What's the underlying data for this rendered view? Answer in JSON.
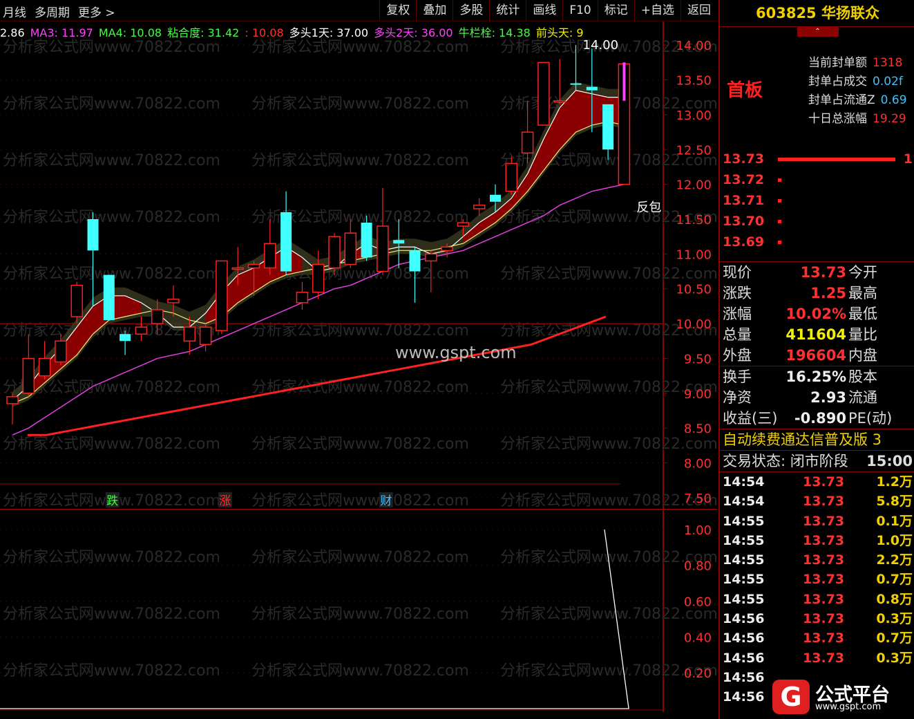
{
  "toolbar": {
    "left": [
      "月线",
      "多周期",
      "更多 >"
    ],
    "right": [
      "复权",
      "叠加",
      "多股",
      "统计",
      "画线",
      "F10",
      "标记",
      "+自选",
      "返回"
    ]
  },
  "ma_line": [
    {
      "label": "2.86",
      "color": "#ffffff"
    },
    {
      "label": "MA3: 11.97",
      "color": "#ff40ff"
    },
    {
      "label": "MA4: 10.08",
      "color": "#40ff40"
    },
    {
      "label": "粘合度: 31.42",
      "color": "#40ff40"
    },
    {
      "label": ": 10.08",
      "color": "#ff3030"
    },
    {
      "label": "多头1天: 37.00",
      "color": "#ffffff"
    },
    {
      "label": "多头2天: 36.00",
      "color": "#ff40ff"
    },
    {
      "label": "牛栏栓: 14.38",
      "color": "#40ff40"
    },
    {
      "label": "前头天: 9",
      "color": "#f0f000"
    }
  ],
  "chart_data": [
    {
      "type": "candlestick",
      "ylim": [
        7.35,
        14.25
      ],
      "yticks": [
        "14.00",
        "13.50",
        "13.00",
        "12.50",
        "12.00",
        "11.50",
        "11.00",
        "10.50",
        "10.00",
        "9.50",
        "9.00",
        "8.50",
        "8.00",
        "7.50"
      ],
      "ytick_values": [
        14.0,
        13.5,
        13.0,
        12.5,
        12.0,
        11.5,
        11.0,
        10.5,
        10.0,
        9.5,
        9.0,
        8.5,
        8.0,
        7.5
      ],
      "candles": [
        {
          "o": 8.85,
          "h": 9.0,
          "l": 8.55,
          "c": 8.95,
          "up": true
        },
        {
          "o": 9.0,
          "h": 9.85,
          "l": 8.95,
          "c": 9.5,
          "up": true
        },
        {
          "o": 9.25,
          "h": 9.75,
          "l": 9.2,
          "c": 9.5,
          "up": true
        },
        {
          "o": 9.45,
          "h": 9.85,
          "l": 9.4,
          "c": 9.75,
          "up": true
        },
        {
          "o": 10.1,
          "h": 10.6,
          "l": 10.0,
          "c": 10.55,
          "up": true
        },
        {
          "o": 11.5,
          "h": 11.6,
          "l": 10.25,
          "c": 11.05,
          "up": false
        },
        {
          "o": 10.7,
          "h": 10.7,
          "l": 10.05,
          "c": 10.05,
          "up": false
        },
        {
          "o": 9.85,
          "h": 9.9,
          "l": 9.55,
          "c": 9.75,
          "up": false
        },
        {
          "o": 9.85,
          "h": 10.1,
          "l": 9.75,
          "c": 9.95,
          "up": true
        },
        {
          "o": 10.0,
          "h": 10.35,
          "l": 9.85,
          "c": 10.2,
          "up": true
        },
        {
          "o": 10.3,
          "h": 10.55,
          "l": 10.1,
          "c": 10.35,
          "up": true
        },
        {
          "o": 9.95,
          "h": 10.1,
          "l": 9.55,
          "c": 9.75,
          "up": true
        },
        {
          "o": 9.7,
          "h": 10.0,
          "l": 9.6,
          "c": 9.95,
          "up": true
        },
        {
          "o": 9.9,
          "h": 10.9,
          "l": 9.85,
          "c": 10.9,
          "up": true
        },
        {
          "o": 10.8,
          "h": 11.1,
          "l": 10.55,
          "c": 10.8,
          "up": true
        },
        {
          "o": 10.8,
          "h": 10.9,
          "l": 10.4,
          "c": 10.85,
          "up": true
        },
        {
          "o": 10.8,
          "h": 11.5,
          "l": 10.7,
          "c": 11.15,
          "up": true
        },
        {
          "o": 11.6,
          "h": 11.9,
          "l": 10.7,
          "c": 10.75,
          "up": false
        },
        {
          "o": 10.3,
          "h": 10.6,
          "l": 10.2,
          "c": 10.45,
          "up": true
        },
        {
          "o": 10.45,
          "h": 11.05,
          "l": 10.35,
          "c": 10.85,
          "up": true
        },
        {
          "o": 10.8,
          "h": 11.3,
          "l": 10.7,
          "c": 11.25,
          "up": true
        },
        {
          "o": 10.85,
          "h": 11.5,
          "l": 10.8,
          "c": 11.3,
          "up": true
        },
        {
          "o": 11.45,
          "h": 11.55,
          "l": 10.9,
          "c": 10.95,
          "up": false
        },
        {
          "o": 10.75,
          "h": 11.95,
          "l": 10.7,
          "c": 11.4,
          "up": true
        },
        {
          "o": 11.2,
          "h": 11.5,
          "l": 10.8,
          "c": 11.15,
          "up": false
        },
        {
          "o": 11.05,
          "h": 11.1,
          "l": 10.3,
          "c": 10.75,
          "up": false
        },
        {
          "o": 10.9,
          "h": 11.05,
          "l": 10.45,
          "c": 11.0,
          "up": true
        },
        {
          "o": 11.05,
          "h": 11.15,
          "l": 10.95,
          "c": 11.1,
          "up": true
        },
        {
          "o": 11.4,
          "h": 11.5,
          "l": 11.25,
          "c": 11.45,
          "up": true
        },
        {
          "o": 11.65,
          "h": 11.8,
          "l": 11.55,
          "c": 11.7,
          "up": true
        },
        {
          "o": 11.85,
          "h": 12.0,
          "l": 11.6,
          "c": 11.75,
          "up": false
        },
        {
          "o": 11.9,
          "h": 12.4,
          "l": 11.85,
          "c": 12.3,
          "up": true
        },
        {
          "o": 12.45,
          "h": 13.2,
          "l": 12.3,
          "c": 12.75,
          "up": true
        },
        {
          "o": 12.85,
          "h": 13.75,
          "l": 12.85,
          "c": 13.75,
          "up": true
        },
        {
          "o": 13.2,
          "h": 13.8,
          "l": 13.15,
          "c": 13.2,
          "up": true
        },
        {
          "o": 13.45,
          "h": 14.0,
          "l": 13.35,
          "c": 13.45,
          "up": false
        },
        {
          "o": 13.4,
          "h": 13.95,
          "l": 12.75,
          "c": 13.35,
          "up": false
        },
        {
          "o": 13.15,
          "h": 13.15,
          "l": 12.35,
          "c": 12.5,
          "up": false
        },
        {
          "o": 12.0,
          "h": 13.75,
          "l": 12.0,
          "c": 13.73,
          "up": true
        }
      ],
      "white_line": [
        8.9,
        9.1,
        9.4,
        9.65,
        9.95,
        10.25,
        10.4,
        10.4,
        10.3,
        10.15,
        9.95,
        9.95,
        10.15,
        10.45,
        10.7,
        10.8,
        10.95,
        11.1,
        10.95,
        10.75,
        10.8,
        11.0,
        11.15,
        11.05,
        11.1,
        11.1,
        11.0,
        11.05,
        11.25,
        11.45,
        11.6,
        11.8,
        12.15,
        12.65,
        13.1,
        13.35,
        13.3,
        13.25,
        13.25
      ],
      "yellow_line": [
        8.85,
        8.95,
        9.15,
        9.35,
        9.55,
        9.85,
        10.05,
        10.1,
        10.15,
        10.2,
        10.15,
        10.05,
        10.0,
        10.1,
        10.3,
        10.45,
        10.6,
        10.7,
        10.75,
        10.8,
        10.85,
        10.9,
        10.95,
        11.0,
        11.05,
        11.05,
        11.05,
        11.1,
        11.15,
        11.3,
        11.45,
        11.65,
        11.9,
        12.2,
        12.5,
        12.75,
        12.85,
        12.9,
        12.85
      ],
      "magenta_line": [
        8.4,
        8.5,
        8.65,
        8.8,
        8.95,
        9.1,
        9.2,
        9.3,
        9.4,
        9.5,
        9.55,
        9.6,
        9.7,
        9.8,
        9.9,
        10.0,
        10.1,
        10.2,
        10.3,
        10.4,
        10.5,
        10.55,
        10.65,
        10.75,
        10.85,
        10.9,
        10.95,
        11.0,
        11.05,
        11.15,
        11.25,
        11.35,
        11.45,
        11.55,
        11.7,
        11.8,
        11.9,
        11.95,
        12.0
      ],
      "red_thick_line": [
        8.4,
        8.4,
        8.45,
        8.5,
        8.55,
        8.6,
        8.65,
        8.7,
        8.75,
        8.8,
        8.85,
        8.9,
        8.95,
        9.0,
        9.05,
        9.1,
        9.15,
        9.2,
        9.25,
        9.3,
        9.35,
        9.4,
        9.45,
        9.5,
        9.55,
        9.6,
        9.65,
        9.7,
        9.8,
        9.9,
        10.0,
        10.1
      ],
      "hline": 10.0,
      "annotations": [
        {
          "text": "14.00",
          "candle": 35,
          "value": 14.0
        },
        {
          "text": "反包",
          "candle": 38,
          "value": 11.75
        }
      ],
      "markers": [
        {
          "text": "跌",
          "candle": 6,
          "color": "#40ff40"
        },
        {
          "text": "涨",
          "candle": 13,
          "color": "#ff3030"
        },
        {
          "text": "财",
          "candle": 23,
          "color": "#40c0ff"
        }
      ]
    },
    {
      "type": "line",
      "ylim": [
        0.0,
        1.1
      ],
      "yticks": [
        "1.00",
        "0.80",
        "0.60",
        "0.40",
        "0.20"
      ],
      "ytick_values": [
        1.0,
        0.8,
        0.6,
        0.4,
        0.2
      ],
      "values": [
        0,
        0,
        0,
        0,
        0,
        0,
        0,
        0,
        0,
        0,
        0,
        0,
        0,
        0,
        0,
        0,
        0,
        0,
        0,
        0,
        0,
        0,
        0,
        0,
        0,
        0,
        0,
        0,
        0,
        0,
        0,
        0,
        0,
        0,
        0,
        0,
        0,
        0,
        1.0
      ]
    }
  ],
  "watermarks": {
    "repeat": "分析家公式网www.70822.com",
    "site": "www.gspt.com"
  },
  "panel": {
    "title": "603825 华扬联众",
    "board": "首板",
    "seal": [
      {
        "k": "当前封单额",
        "v": "1318"
      },
      {
        "k": "封单占成交",
        "v": "0.02f"
      },
      {
        "k": "封单占流通Z",
        "v": "0.69"
      },
      {
        "k": "十日总涨幅",
        "v": "19.29"
      }
    ],
    "book": [
      {
        "price": "13.73",
        "bar": 0.92
      },
      {
        "price": "13.72",
        "bar": 0
      },
      {
        "price": "13.71",
        "bar": 0
      },
      {
        "price": "13.70",
        "bar": 0
      },
      {
        "price": "13.69",
        "bar": 0
      }
    ],
    "book_end": "1",
    "quote": [
      {
        "k": "现价",
        "v": "13.73",
        "c": "#ff3030",
        "k2": "今开"
      },
      {
        "k": "涨跌",
        "v": "1.25",
        "c": "#ff3030",
        "k2": "最高"
      },
      {
        "k": "涨幅",
        "v": "10.02%",
        "c": "#ff3030",
        "k2": "最低"
      },
      {
        "k": "总量",
        "v": "411604",
        "c": "#f0f000",
        "k2": "量比"
      },
      {
        "k": "外盘",
        "v": "196604",
        "c": "#ff3030",
        "k2": "内盘"
      }
    ],
    "quote2": [
      {
        "k": "换手",
        "v": "16.25%",
        "c": "#eeeeee",
        "k2": "股本"
      },
      {
        "k": "净资",
        "v": "2.93",
        "c": "#eeeeee",
        "k2": "流通"
      },
      {
        "k": "收益(三)",
        "v": "-0.890",
        "c": "#eeeeee",
        "k2": "PE(动)"
      }
    ],
    "ad": "自动续费通达信普及版 3",
    "status_label": "交易状态: 闭市阶段",
    "status_time": "15:00",
    "ticks": [
      {
        "t": "14:54",
        "p": "13.73",
        "v": "1.2万"
      },
      {
        "t": "14:54",
        "p": "13.73",
        "v": "5.8万"
      },
      {
        "t": "14:55",
        "p": "13.73",
        "v": "0.1万"
      },
      {
        "t": "14:55",
        "p": "13.73",
        "v": "1.0万"
      },
      {
        "t": "14:55",
        "p": "13.73",
        "v": "2.2万"
      },
      {
        "t": "14:55",
        "p": "13.73",
        "v": "0.7万"
      },
      {
        "t": "14:55",
        "p": "13.73",
        "v": "0.8万"
      },
      {
        "t": "14:56",
        "p": "13.73",
        "v": "0.3万"
      },
      {
        "t": "14:56",
        "p": "13.73",
        "v": "0.7万"
      },
      {
        "t": "14:56",
        "p": "13.73",
        "v": "0.3万"
      },
      {
        "t": "14:56",
        "p": "",
        "v": ""
      },
      {
        "t": "14:56",
        "p": "",
        "v": ""
      }
    ]
  },
  "logo": {
    "mark": "G",
    "text": "公式平台",
    "url": "www.gspt.com"
  }
}
